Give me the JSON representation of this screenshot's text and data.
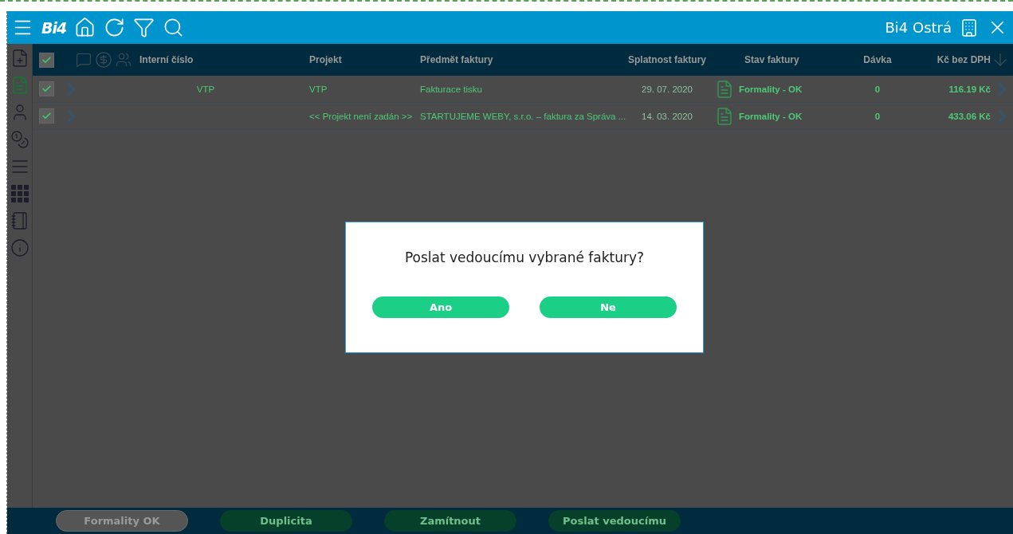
{
  "header": {
    "logo": "Bi4",
    "title": "Bi4 Ostrá"
  },
  "sidebar": {
    "items": [
      {
        "kind": "new-document",
        "selected": false
      },
      {
        "kind": "document",
        "selected": true
      },
      {
        "kind": "person",
        "selected": false
      },
      {
        "kind": "coins",
        "selected": false
      },
      {
        "kind": "list",
        "selected": false
      },
      {
        "kind": "grid",
        "selected": false
      },
      {
        "kind": "notebook",
        "selected": false
      },
      {
        "kind": "info",
        "selected": false
      }
    ]
  },
  "table": {
    "all_checked": true,
    "columns": [
      "Interní číslo",
      "Projekt",
      "Předmět faktury",
      "Splatnost faktury",
      "Stav faktury",
      "Dávka",
      "Kč bez DPH"
    ],
    "rows": [
      {
        "checked": true,
        "cells": [
          "VTP",
          "VTP",
          "Fakturace tisku",
          "29. 07. 2020",
          "Formality - OK",
          "0",
          "116.19 Kč"
        ]
      },
      {
        "checked": true,
        "cells": [
          "",
          "<< Projekt není zadán >>",
          "STARTUJEME WEBY, s.r.o. – faktura za Správa ...",
          "14. 03. 2020",
          "Formality - OK",
          "0",
          "433.06 Kč"
        ]
      }
    ]
  },
  "dialog": {
    "question": "Poslat vedoucímu vybrané faktury?",
    "buttons": [
      "Ano",
      "Ne"
    ]
  },
  "footer": {
    "buttons": [
      {
        "label": "Formality OK",
        "disabled": true
      },
      {
        "label": "Duplicita",
        "disabled": false
      },
      {
        "label": "Zamítnout",
        "disabled": false
      },
      {
        "label": "Poslat vedoucímu",
        "disabled": false
      }
    ]
  }
}
